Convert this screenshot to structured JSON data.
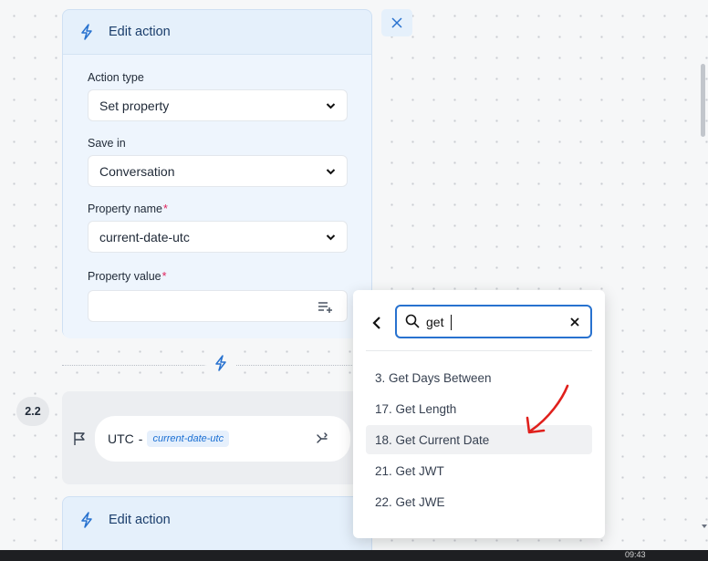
{
  "edit_panel": {
    "title": "Edit action",
    "fields": {
      "action_type": {
        "label": "Action type",
        "value": "Set property"
      },
      "save_in": {
        "label": "Save in",
        "value": "Conversation"
      },
      "property_name": {
        "label": "Property name",
        "value": "current-date-utc",
        "required_mark": "*"
      },
      "property_value": {
        "label": "Property value",
        "value": "",
        "required_mark": "*"
      }
    }
  },
  "step": {
    "number": "2.2",
    "name": "UTC",
    "separator": "-",
    "property_tag": "current-date-utc"
  },
  "next_panel": {
    "title": "Edit action"
  },
  "dropdown": {
    "search_value": "get",
    "items": [
      {
        "label": "3. Get Days Between",
        "highlighted": false
      },
      {
        "label": "17. Get Length",
        "highlighted": false
      },
      {
        "label": "18. Get Current Date",
        "highlighted": true
      },
      {
        "label": "21. Get JWT",
        "highlighted": false
      },
      {
        "label": "22. Get JWE",
        "highlighted": false
      }
    ]
  },
  "annotation": {
    "color": "#e0201c"
  },
  "taskbar": {
    "clock": "09:43"
  },
  "colors": {
    "accent": "#2872cf",
    "panel_bg": "#e5f0fb",
    "tag_text": "#1a6fd3"
  },
  "icons": [
    "bolt-icon",
    "close-icon",
    "chevron-down-icon",
    "insert-variable-icon",
    "flag-icon",
    "branch-icon",
    "back-chevron-icon",
    "search-icon",
    "clear-icon"
  ]
}
